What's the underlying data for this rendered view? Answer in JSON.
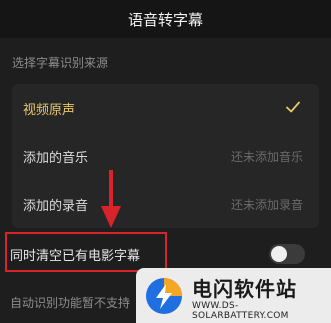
{
  "header": {
    "title": "语音转字幕"
  },
  "section": {
    "label": "选择字幕识别来源"
  },
  "sources": [
    {
      "label": "视频原声",
      "value": "",
      "selected": true
    },
    {
      "label": "添加的音乐",
      "value": "还未添加音乐",
      "selected": false
    },
    {
      "label": "添加的录音",
      "value": "还未添加录音",
      "selected": false
    }
  ],
  "clear_option": {
    "label": "同时清空已有电影字幕",
    "enabled": false
  },
  "footer": {
    "note": "自动识别功能暂不支持"
  },
  "watermark": {
    "title": "电闪软件站",
    "subtitle": "WWW.DS-SOLARBATTERY.COM"
  },
  "colors": {
    "background": "#1e1e1e",
    "accent": "#e8c86b",
    "highlight": "#d8232a",
    "brand_blue": "#1f6fe0",
    "brand_orange": "#f5a623"
  },
  "icons": {
    "check": "check-icon",
    "arrow": "down-arrow-annotation",
    "logo": "lightning-logo"
  }
}
